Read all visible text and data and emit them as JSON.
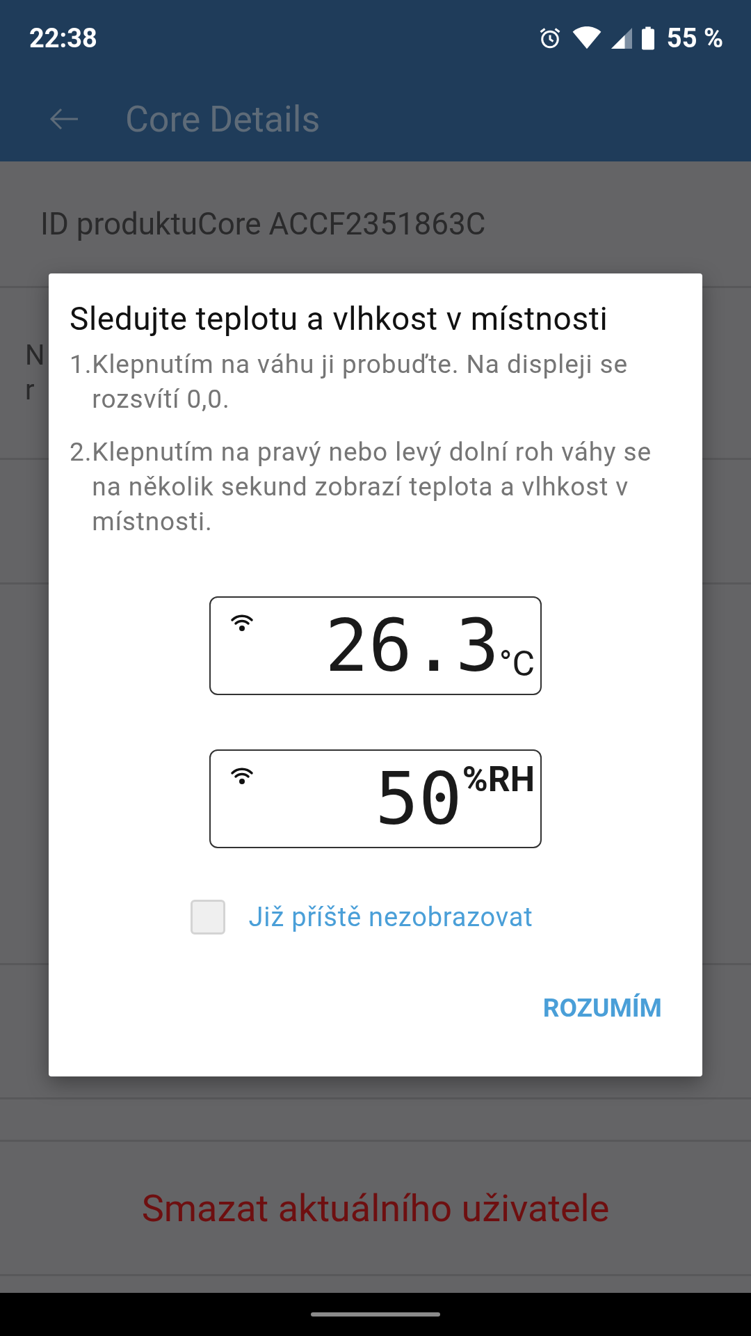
{
  "status_bar": {
    "time": "22:38",
    "battery": "55 %"
  },
  "app_bar": {
    "title": "Core Details"
  },
  "product_id": "ID produktuCore ACCF2351863C",
  "partial_row": {
    "lines": [
      "N",
      "r"
    ]
  },
  "delete_action": "Smazat aktuálního uživatele",
  "dialog": {
    "title": "Sledujte teplotu a vlhkost v místnosti",
    "steps": [
      {
        "number": "1.",
        "text": "Klepnutím na váhu ji probuďte. Na displeji se rozsvítí 0,0."
      },
      {
        "number": "2.",
        "text": "Klepnutím na pravý nebo levý dolní roh váhy se na několik sekund zobrazí teplota a vlhkost v místnosti."
      }
    ],
    "displays": [
      {
        "reading": "26.3",
        "unit": "°C",
        "kind": "temperature"
      },
      {
        "reading": "50",
        "unit": "%RH",
        "kind": "humidity"
      }
    ],
    "checkbox": {
      "label": "Již příště nezobrazovat",
      "checked": false
    },
    "button": "ROZUMÍM"
  }
}
